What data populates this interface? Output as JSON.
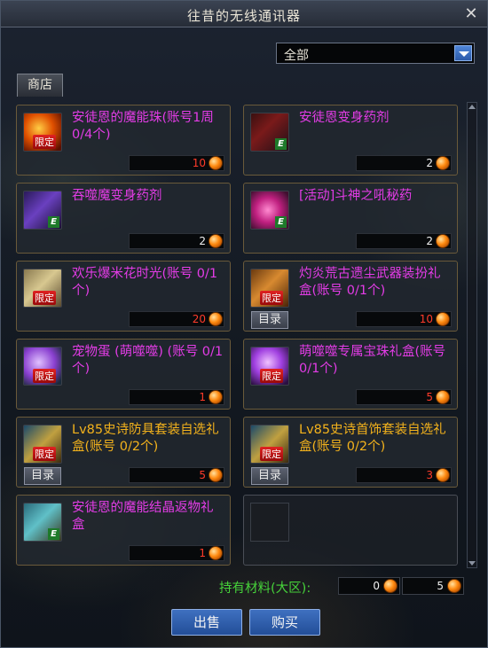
{
  "window": {
    "title": "往昔的无线通讯器",
    "close_label": "✕"
  },
  "filter": {
    "selected": "全部"
  },
  "tab": {
    "label": "商店"
  },
  "items": [
    {
      "name": "安徒恩的魔能珠(账号1周 0/4个)",
      "price": "10",
      "color": "magenta",
      "icon": "red-orb-icon",
      "limited": true,
      "catalog": false
    },
    {
      "name": "安徒恩变身药剂",
      "price": "2",
      "color": "magenta",
      "icon": "dark-armor-icon",
      "limited": false,
      "catalog": false
    },
    {
      "name": "吞噬魔变身药剂",
      "price": "2",
      "color": "magenta",
      "icon": "purple-character-icon",
      "limited": false,
      "catalog": false
    },
    {
      "name": "[活动]斗神之吼秘药",
      "price": "2",
      "color": "magenta",
      "icon": "red-potion-icon",
      "limited": false,
      "catalog": false
    },
    {
      "name": "欢乐爆米花时光(账号 0/1个)",
      "price": "20",
      "color": "magenta",
      "icon": "popcorn-icon",
      "limited": true,
      "catalog": false
    },
    {
      "name": "灼炎荒古遗尘武器装扮礼盒(账号 0/1个)",
      "price": "10",
      "color": "magenta",
      "icon": "weapon-box-icon",
      "limited": true,
      "catalog": true
    },
    {
      "name": "宠物蛋 (萌噬噬) (账号 0/1个)",
      "price": "1",
      "color": "magenta",
      "icon": "pet-egg-icon",
      "limited": true,
      "catalog": false
    },
    {
      "name": "萌噬噬专属宝珠礼盒(账号 0/1个)",
      "price": "5",
      "color": "magenta",
      "icon": "purple-orb-icon",
      "limited": true,
      "catalog": false
    },
    {
      "name": "Lv85史诗防具套装自选礼盒(账号 0/2个)",
      "price": "5",
      "color": "gold",
      "icon": "armor-chest-icon",
      "limited": true,
      "catalog": true
    },
    {
      "name": "Lv85史诗首饰套装自选礼盒(账号 0/2个)",
      "price": "3",
      "color": "gold",
      "icon": "accessory-chest-icon",
      "limited": true,
      "catalog": true
    },
    {
      "name": "安徒恩的魔能结晶返物礼盒",
      "price": "1",
      "color": "magenta",
      "icon": "crystal-chest-icon",
      "limited": false,
      "catalog": false
    }
  ],
  "labels": {
    "limited": "限定",
    "catalog": "目录",
    "equip_mark": "E"
  },
  "materials": {
    "label": "持有材料(大区):",
    "owned": "0",
    "required": "5"
  },
  "buttons": {
    "sell": "出售",
    "buy": "购买"
  },
  "colors": {
    "magenta": "#e33ce6",
    "gold": "#f3b21c",
    "price_red": "#ff3b2a",
    "material_green": "#46d23a",
    "button_blue": "#2f5fb0"
  }
}
